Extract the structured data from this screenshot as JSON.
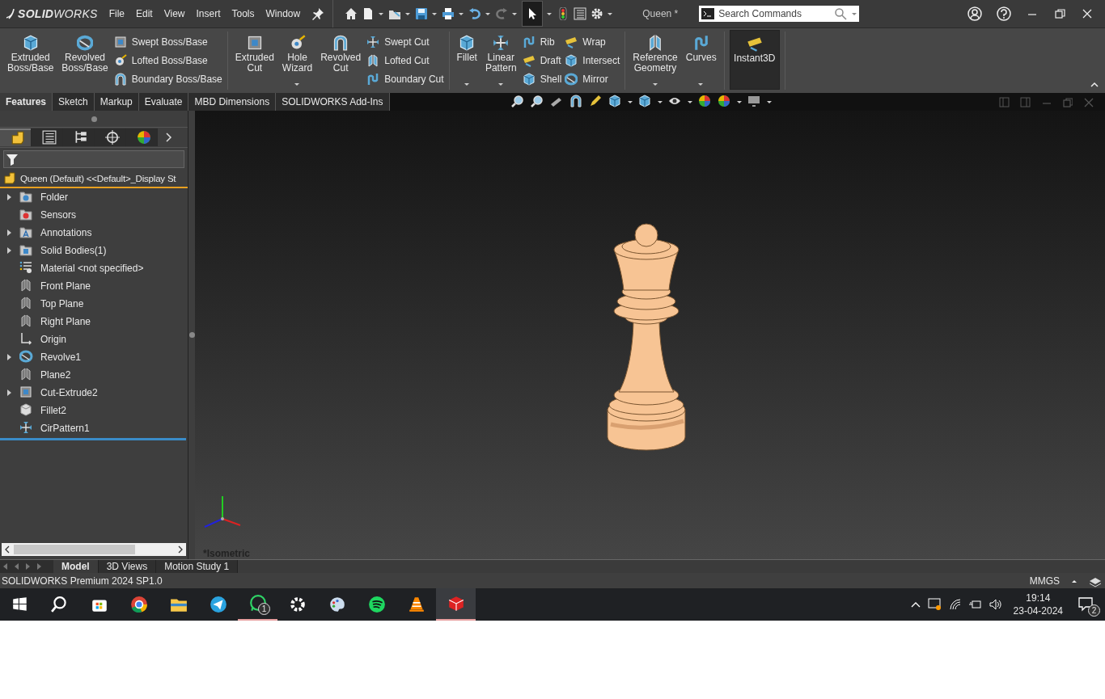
{
  "app_bar": {
    "logo": "**SOLID**WORKS",
    "menu": [
      "File",
      "Edit",
      "View",
      "Insert",
      "Tools",
      "Window"
    ],
    "quick_access": {
      "select_on": true,
      "redo_disabled": true
    },
    "document_title": "Queen *",
    "search": {
      "placeholder": "Search Commands"
    }
  },
  "ribbon": {
    "groups": [
      {
        "columns": [
          {
            "kind": "large",
            "label": "Extruded Boss/Base",
            "dropdown": false,
            "on": false
          },
          {
            "kind": "large",
            "label": "Revolved Boss/Base",
            "dropdown": false,
            "on": false
          },
          {
            "kind": "stack",
            "items": [
              "Swept Boss/Base",
              "Lofted Boss/Base",
              "Boundary Boss/Base"
            ]
          }
        ]
      },
      {
        "columns": [
          {
            "kind": "large",
            "label": "Extruded Cut",
            "dropdown": false,
            "on": false
          },
          {
            "kind": "large",
            "label": "Hole Wizard",
            "dropdown": true,
            "on": false
          },
          {
            "kind": "large",
            "label": "Revolved Cut",
            "dropdown": false,
            "on": false
          },
          {
            "kind": "stack",
            "items": [
              "Swept Cut",
              "Lofted Cut",
              "Boundary Cut"
            ]
          }
        ]
      },
      {
        "columns": [
          {
            "kind": "large",
            "label": "Fillet",
            "dropdown": true,
            "on": false
          },
          {
            "kind": "large",
            "label": "Linear Pattern",
            "dropdown": true,
            "on": false
          },
          {
            "kind": "stack",
            "items": [
              "Rib",
              "Draft",
              "Shell"
            ]
          },
          {
            "kind": "stack",
            "items": [
              "Wrap",
              "Intersect",
              "Mirror"
            ]
          }
        ]
      },
      {
        "columns": [
          {
            "kind": "large",
            "label": "Reference Geometry",
            "dropdown": true,
            "on": false
          },
          {
            "kind": "large",
            "label": "Curves",
            "dropdown": true,
            "on": false
          }
        ]
      },
      {
        "columns": [
          {
            "kind": "large",
            "label": "Instant3D",
            "dropdown": false,
            "on": true
          }
        ]
      }
    ]
  },
  "tabs": [
    {
      "label": "Features",
      "selected": true
    },
    {
      "label": "Sketch",
      "selected": false
    },
    {
      "label": "Markup",
      "selected": false
    },
    {
      "label": "Evaluate",
      "selected": false
    },
    {
      "label": "MBD Dimensions",
      "selected": false
    },
    {
      "label": "SOLIDWORKS Add-Ins",
      "selected": false
    }
  ],
  "panel_tabs": [
    {
      "selected": true
    },
    {
      "selected": false
    },
    {
      "selected": false
    },
    {
      "selected": false
    },
    {
      "selected": false
    }
  ],
  "tree": {
    "root": "Queen (Default) <<Default>_Display St",
    "items": [
      {
        "label": "Folder",
        "kind": "folder",
        "expandable": true
      },
      {
        "label": "Sensors",
        "kind": "sensor",
        "expandable": false
      },
      {
        "label": "Annotations",
        "kind": "annotation",
        "expandable": true
      },
      {
        "label": "Solid Bodies(1)",
        "kind": "bodies",
        "expandable": true
      },
      {
        "label": "Material <not specified>",
        "kind": "material",
        "expandable": false
      },
      {
        "label": "Front Plane",
        "kind": "plane",
        "expandable": false
      },
      {
        "label": "Top Plane",
        "kind": "plane",
        "expandable": false
      },
      {
        "label": "Right Plane",
        "kind": "plane",
        "expandable": false
      },
      {
        "label": "Origin",
        "kind": "origin",
        "expandable": false
      },
      {
        "label": "Revolve1",
        "kind": "revolve",
        "expandable": true
      },
      {
        "label": "Plane2",
        "kind": "plane",
        "expandable": false
      },
      {
        "label": "Cut-Extrude2",
        "kind": "cut",
        "expandable": true
      },
      {
        "label": "Fillet2",
        "kind": "fillet",
        "expandable": false
      },
      {
        "label": "CirPattern1",
        "kind": "pattern",
        "expandable": false
      }
    ]
  },
  "viewport": {
    "view_label": "*Isometric"
  },
  "bottom_tabs": [
    {
      "label": "Model",
      "selected": true
    },
    {
      "label": "3D Views",
      "selected": false
    },
    {
      "label": "Motion Study 1",
      "selected": false
    }
  ],
  "status_bar": {
    "text": "SOLIDWORKS Premium 2024 SP1.0",
    "units": "MMGS"
  },
  "taskbar": {
    "whatsapp_badge": "1",
    "time": "19:14",
    "date": "23-04-2024",
    "notifications": "2"
  }
}
